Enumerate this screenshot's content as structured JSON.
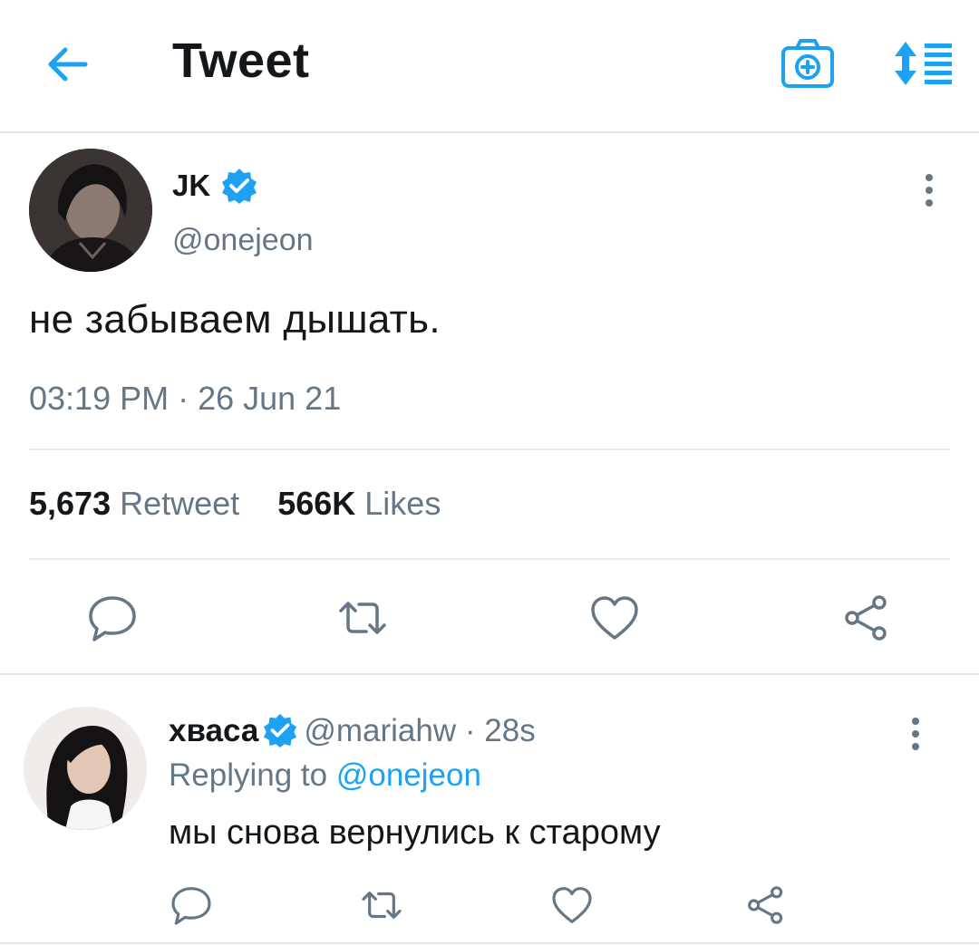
{
  "header": {
    "title": "Tweet",
    "back_icon": "arrow-left-icon",
    "camera_icon": "camera-icon",
    "sort_icon": "sort-icon"
  },
  "main_tweet": {
    "name": "JK",
    "handle": "@onejeon",
    "text": "не забываем дышать.",
    "timestamp": "03:19 PM · 26 Jun 21",
    "retweets_count": "5,673",
    "retweets_label": "Retweet",
    "likes_count": "566K",
    "likes_label": "Likes",
    "verified": true
  },
  "reply_tweet": {
    "name": "хваса",
    "handle": "@mariahw",
    "dot": "·",
    "time": "28s",
    "replying_prefix": "Replying to",
    "replying_to": "@onejeon",
    "text": "мы снова вернулись к старому",
    "verified": true
  },
  "colors": {
    "accent": "#1da1f2",
    "muted": "#657786",
    "text": "#14171a",
    "divider": "#e6ecf0"
  }
}
